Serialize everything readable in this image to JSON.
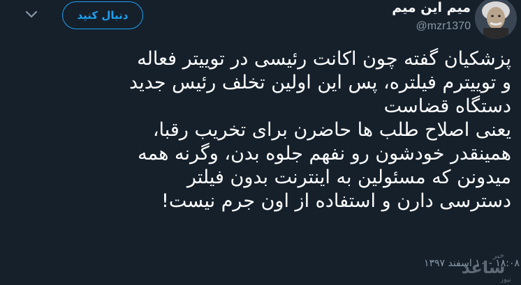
{
  "user": {
    "display_name": "میم این میم",
    "handle": "@mzr1370"
  },
  "follow_button": {
    "label": "دنبال کنید"
  },
  "tweet": {
    "lines": [
      "پزشکیان گفته چون اکانت رئیسی در توییتر فعاله",
      "و توییترم فیلتره، پس این اولین تخلف رئیس جدید",
      "دستگاه قضاست",
      "یعنی اصلاح طلب ها حاضرن برای تخریب رقبا،",
      "همینقدر خودشون رو نفهم جلوه بدن، وگرنه همه",
      "میدونن که مسئولین به اینترنت بدون فیلتر",
      "دسترسی دارن و استفاده از اون جرم نیست!"
    ],
    "timestamp": "۱۸:۰۸ - ۱۰ اسفند ۱۳۹۷"
  },
  "watermark": {
    "lines": [
      "خبر",
      "ساعد",
      "نیوز"
    ]
  },
  "colors": {
    "background": "#15202b",
    "accent": "#1da1f2",
    "secondary_text": "#8899a6",
    "primary_text": "#ffffff"
  },
  "icons": {
    "more": "chevron-down-icon",
    "avatar": "avatar"
  }
}
